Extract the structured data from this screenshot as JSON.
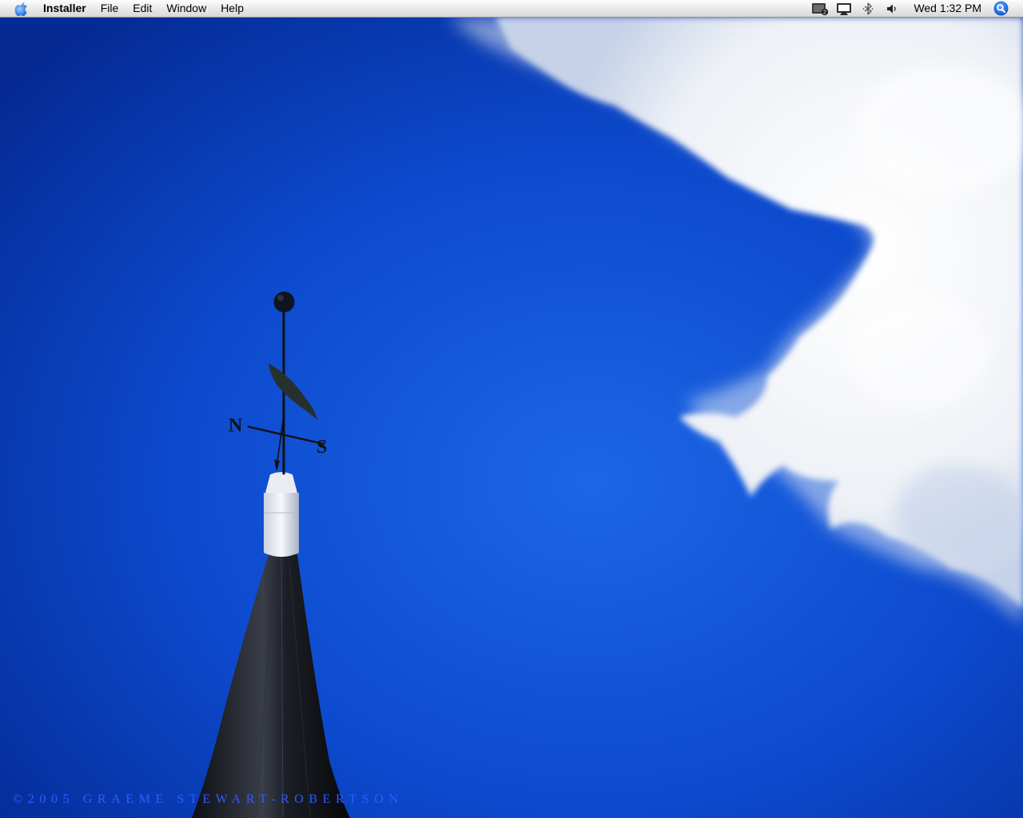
{
  "menubar": {
    "apple_icon": "apple-logo-icon",
    "app_name": "Installer",
    "items": [
      "File",
      "Edit",
      "Window",
      "Help"
    ],
    "status": {
      "spaces_icon": "spaces-icon",
      "spaces_badge": "2",
      "display_icon": "display-mirroring-icon",
      "bluetooth_icon": "bluetooth-icon",
      "volume_icon": "volume-icon",
      "clock": "Wed 1:32 PM",
      "spotlight_icon": "spotlight-search-icon"
    }
  },
  "desktop": {
    "wallpaper_credit": "©2005 GRAEME STEWART-ROBERTSON",
    "weathervane_letters": [
      "N",
      "S"
    ],
    "colors": {
      "sky_deep": "#0a3fc0",
      "sky_light": "#1d66e6",
      "cloud": "#f2f4f8",
      "spire": "#1a1c22",
      "credit": "#2f5cff"
    }
  }
}
